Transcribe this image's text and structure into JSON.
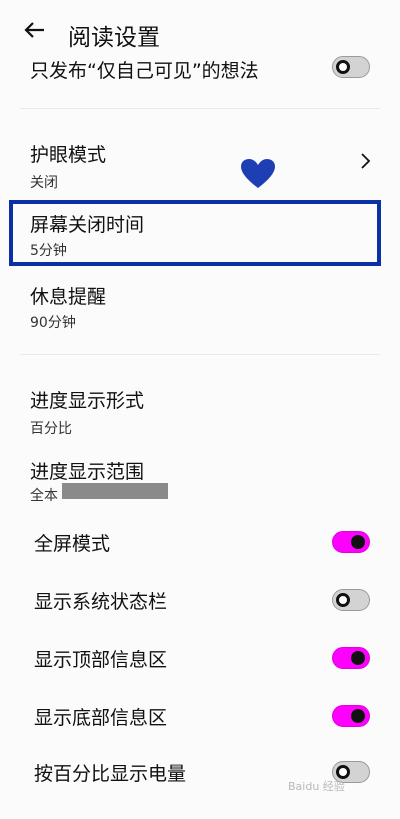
{
  "header": {
    "title": "阅读设置"
  },
  "items": {
    "thoughts_private": {
      "title": "只发布“仅自己可见”的想法",
      "on": false
    },
    "eye_care": {
      "title": "护眼模式",
      "value": "关闭"
    },
    "screen_off": {
      "title": "屏幕关闭时间",
      "value": "5分钟"
    },
    "rest_reminder": {
      "title": "休息提醒",
      "value": "90分钟"
    },
    "progress_format": {
      "title": "进度显示形式",
      "value": "百分比"
    },
    "progress_range": {
      "title": "进度显示范围",
      "value": "全本"
    },
    "fullscreen": {
      "title": "全屏模式",
      "on": true
    },
    "status_bar": {
      "title": "显示系统状态栏",
      "on": false
    },
    "top_info": {
      "title": "显示顶部信息区",
      "on": true
    },
    "bottom_info": {
      "title": "显示底部信息区",
      "on": true
    },
    "battery_percent": {
      "title": "按百分比显示电量",
      "on": false
    }
  },
  "watermark": "Baidu 经验",
  "colors": {
    "toggle_on": "#ff00ff",
    "highlight_border": "#0b2fa5",
    "heart": "#1e3fb4"
  },
  "icons": {
    "back": "arrow-left-icon",
    "chevron": "chevron-right-icon",
    "heart": "heart-icon"
  }
}
